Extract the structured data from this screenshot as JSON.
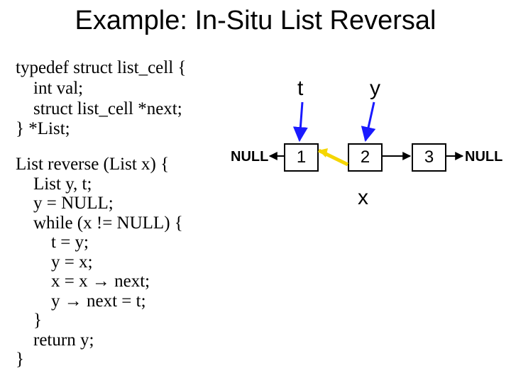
{
  "title": "Example: In-Situ List Reversal",
  "code": {
    "typedef": "typedef struct list_cell {\n    int val;\n    struct list_cell *next;\n} *List;",
    "reverse": "List reverse (List x) {\n    List y, t;\n    y = NULL;\n    while (x != NULL) {\n        t = y;\n        y = x;\n        x = x → next;\n        y → next = t;\n    }\n    return y;\n}"
  },
  "diagram": {
    "pointers": {
      "t": "t",
      "y": "y",
      "x": "x"
    },
    "null_left": "NULL",
    "null_right": "NULL",
    "nodes": {
      "n1": "1",
      "n2": "2",
      "n3": "3"
    }
  }
}
